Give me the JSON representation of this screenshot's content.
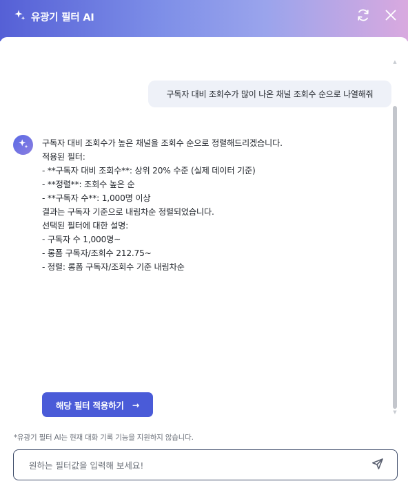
{
  "header": {
    "title": "유광기 필터 AI",
    "title_icon": "sparkle-icon",
    "refresh_icon": "refresh-icon",
    "close_icon": "close-icon"
  },
  "chat": {
    "user_message": "구독자 대비 조회수가 많이 나온 채널 조회수 순으로 나열해줘",
    "bot_icon": "sparkle-icon",
    "bot_lines": [
      "구독자 대비 조회수가 높은 채널을 조회수 순으로 정렬해드리겠습니다.",
      "",
      "적용된 필터:",
      "- **구독자 대비 조회수**: 상위 20% 수준 (실제 데이터 기준)",
      "- **정렬**: 조회수 높은 순",
      "- **구독자 수**: 1,000명 이상",
      "",
      "결과는 구독자 기준으로 내림차순 정렬되었습니다.",
      "",
      "",
      "",
      "선택된 필터에 대한 설명:",
      "",
      "- 구독자 수 1,000명~",
      "",
      "- 롱폼 구독자/조회수 212.75~",
      "",
      "- 정렬: 롱폼 구독자/조회수 기준 내림차순"
    ],
    "apply_button": "해당 필터 적용하기",
    "apply_arrow": "→"
  },
  "footer": {
    "disclaimer": "*유광기 필터 AI는 현재 대화 기록 기능을 지원하지 않습니다.",
    "input_placeholder": "원하는 필터값을 입력해 보세요!",
    "input_value": "",
    "send_icon": "send-icon"
  },
  "colors": {
    "accent": "#4a5bd8",
    "header_gradient_start": "#5560d6",
    "header_gradient_end": "#d9a9df",
    "user_bubble": "#eef1f8"
  }
}
